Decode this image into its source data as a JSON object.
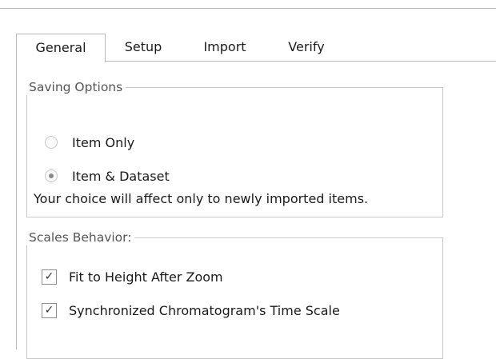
{
  "tabs": [
    {
      "label": "General",
      "active": true
    },
    {
      "label": "Setup",
      "active": false
    },
    {
      "label": "Import",
      "active": false
    },
    {
      "label": "Verify",
      "active": false
    }
  ],
  "saving_options": {
    "legend": "Saving Options",
    "options": [
      {
        "label": "Item Only",
        "selected": false
      },
      {
        "label": "Item & Dataset",
        "selected": true
      }
    ],
    "note": "Your choice will affect only to newly imported  items."
  },
  "scales_behavior": {
    "legend": "Scales Behavior:",
    "options": [
      {
        "label": "Fit to Height After Zoom",
        "checked": true
      },
      {
        "label": "Synchronized Chromatogram's Time Scale",
        "checked": true
      }
    ]
  },
  "icons": {
    "checkmark": "✓"
  }
}
